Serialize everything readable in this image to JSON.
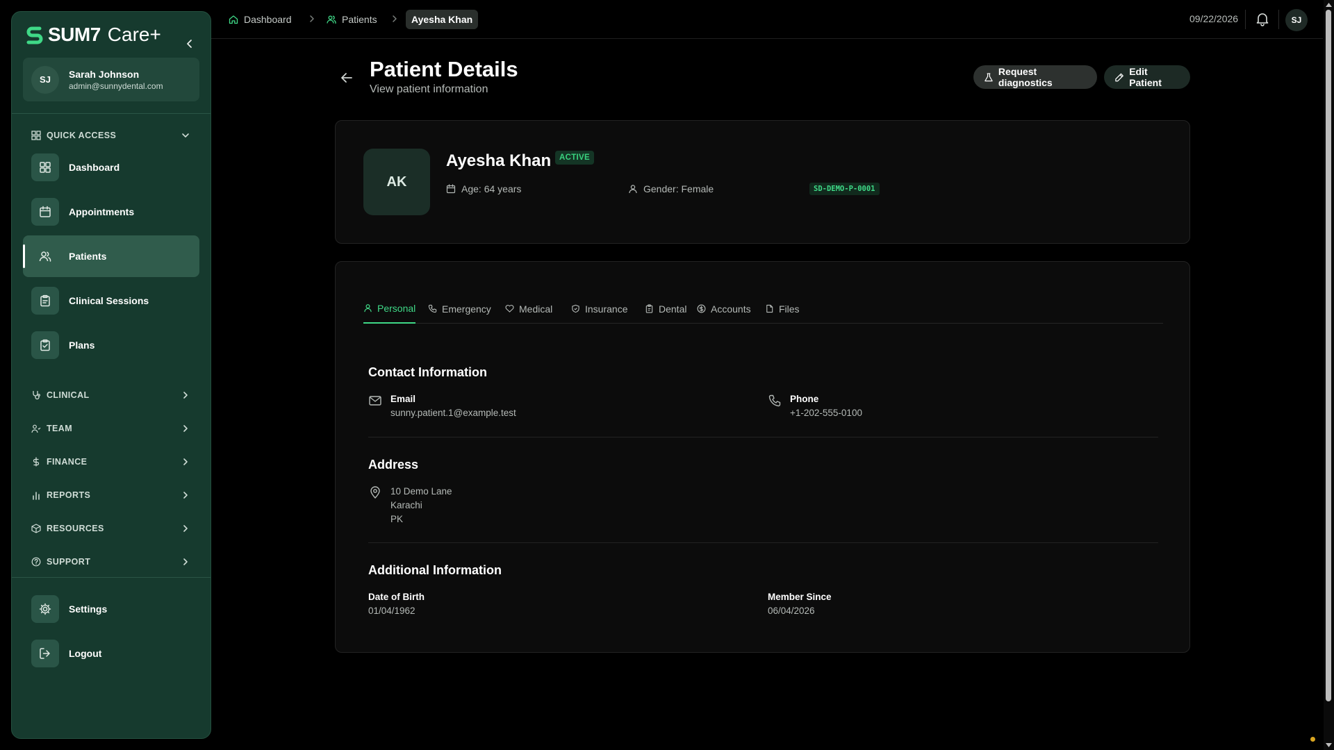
{
  "app": {
    "brand_name": "SUM7",
    "brand_suffix": "Care+"
  },
  "user": {
    "initials": "SJ",
    "name": "Sarah Johnson",
    "email": "admin@sunnydental.com"
  },
  "sidebar": {
    "quick_access_label": "QUICK ACCESS",
    "quick_items": [
      {
        "label": "Dashboard",
        "icon": "grid-icon"
      },
      {
        "label": "Appointments",
        "icon": "calendar-icon"
      },
      {
        "label": "Patients",
        "icon": "users-icon",
        "active": true
      },
      {
        "label": "Clinical Sessions",
        "icon": "clipboard-icon"
      },
      {
        "label": "Plans",
        "icon": "clipboard-check-icon"
      }
    ],
    "sections": [
      {
        "label": "CLINICAL",
        "icon": "stethoscope-icon"
      },
      {
        "label": "TEAM",
        "icon": "team-icon"
      },
      {
        "label": "FINANCE",
        "icon": "dollar-icon"
      },
      {
        "label": "REPORTS",
        "icon": "bar-chart-icon"
      },
      {
        "label": "RESOURCES",
        "icon": "package-icon"
      },
      {
        "label": "SUPPORT",
        "icon": "help-circle-icon"
      }
    ],
    "bottom_items": [
      {
        "label": "Settings",
        "icon": "gear-icon"
      },
      {
        "label": "Logout",
        "icon": "logout-icon"
      }
    ]
  },
  "breadcrumb": {
    "items": [
      "Dashboard",
      "Patients",
      "Ayesha Khan"
    ]
  },
  "topbar": {
    "date": "09/22/2026",
    "avatar": "SJ"
  },
  "header": {
    "title": "Patient Details",
    "subtitle": "View patient information",
    "request_btn": "Request diagnostics",
    "edit_btn": "Edit Patient"
  },
  "patient": {
    "initials": "AK",
    "name": "Ayesha Khan",
    "status": "ACTIVE",
    "age": "Age: 64 years",
    "gender": "Gender: Female",
    "code": "SD-DEMO-P-0001"
  },
  "tabs": [
    "Personal",
    "Emergency",
    "Medical",
    "Insurance",
    "Dental",
    "Accounts",
    "Files"
  ],
  "contact": {
    "title": "Contact Information",
    "email_label": "Email",
    "email_value": "sunny.patient.1@example.test",
    "phone_label": "Phone",
    "phone_value": "+1-202-555-0100"
  },
  "address": {
    "title": "Address",
    "lines": [
      "10 Demo Lane",
      "Karachi",
      "PK"
    ]
  },
  "additional": {
    "title": "Additional Information",
    "dob_label": "Date of Birth",
    "dob_value": "01/04/1962",
    "member_label": "Member Since",
    "member_value": "06/04/2026"
  },
  "colors": {
    "accent": "#3fd987",
    "sidebar_bg": "#163a2e",
    "card_bg": "#0c0c0c"
  }
}
